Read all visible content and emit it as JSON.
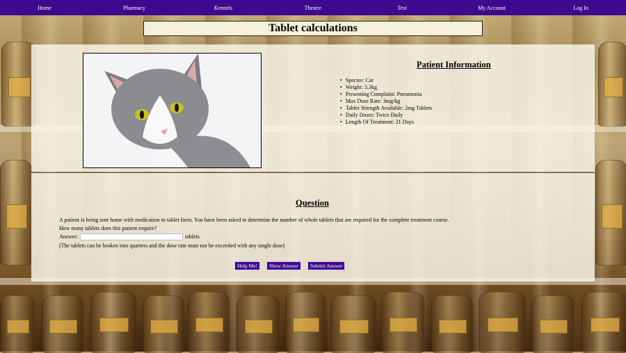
{
  "nav": {
    "items": [
      "Home",
      "Pharmacy",
      "Kennels",
      "Theatre",
      "Test",
      "My Account",
      "Log In"
    ]
  },
  "page_title": "Tablet calculations",
  "patient": {
    "heading": "Patient Information",
    "details": [
      "Species: Cat",
      "Weight: 3.3kg",
      "Presenting Complaint: Pneumonia",
      "Max Dose Rate: 3mg/kg",
      "Tablet Strength Available: 2mg Tablets",
      "Daily Doses: Twice Daily",
      "Length Of Treatment: 21 Days"
    ]
  },
  "question": {
    "heading": "Question",
    "line1": "A patient is being sent home with medication in tablet form. You have been asked to determine the number of whole tablets that are required for the complete treatment course.",
    "line2": "How many tablets does this patient require?",
    "answer_label": "Answer:",
    "answer_value": "",
    "answer_unit": "tablets",
    "note": "(The tablets can be broken into quarters and the dose rate must not be exceeded with any single dose)"
  },
  "buttons": {
    "help": "Help Me!",
    "show": "Show Answer",
    "submit": "Submit Answer"
  },
  "colors": {
    "nav_bg": "#3d0a8f",
    "button_bg": "#3d0a8f"
  }
}
